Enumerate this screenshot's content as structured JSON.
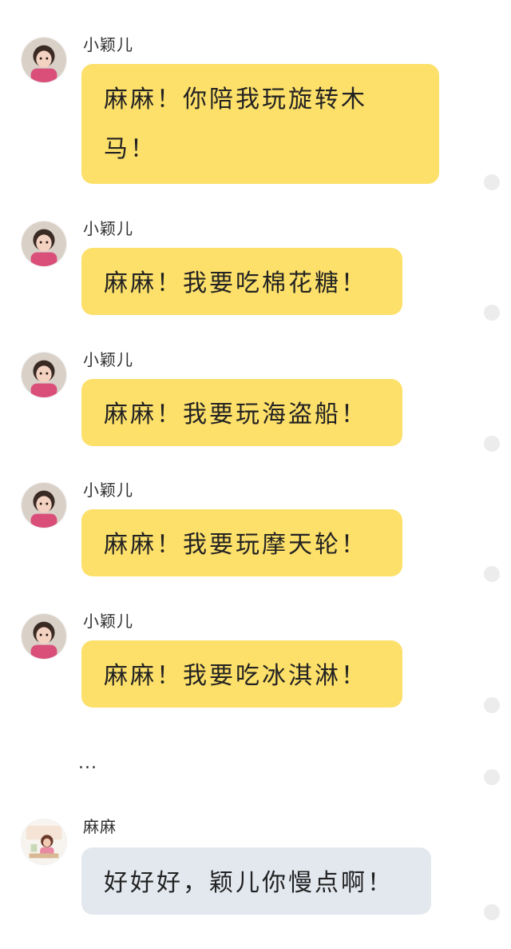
{
  "messages": [
    {
      "sender": "小颖儿",
      "text": "麻麻！你陪我玩旋转木马！",
      "role": "kid"
    },
    {
      "sender": "小颖儿",
      "text": "麻麻！我要吃棉花糖！",
      "role": "kid"
    },
    {
      "sender": "小颖儿",
      "text": "麻麻！我要玩海盗船！",
      "role": "kid"
    },
    {
      "sender": "小颖儿",
      "text": "麻麻！我要玩摩天轮！",
      "role": "kid"
    },
    {
      "sender": "小颖儿",
      "text": "麻麻！我要吃冰淇淋！",
      "role": "kid"
    },
    {
      "sender": "麻麻",
      "text": "好好好，颖儿你慢点啊！",
      "role": "mom"
    }
  ],
  "ellipsis": "...",
  "colors": {
    "kid_bubble": "#fde06a",
    "mom_bubble": "#e3e8ef",
    "status_dot": "#ececec"
  },
  "icons": {
    "kid_avatar": "child-photo-avatar",
    "mom_avatar": "cartoon-mom-avatar",
    "status": "message-status-dot"
  }
}
